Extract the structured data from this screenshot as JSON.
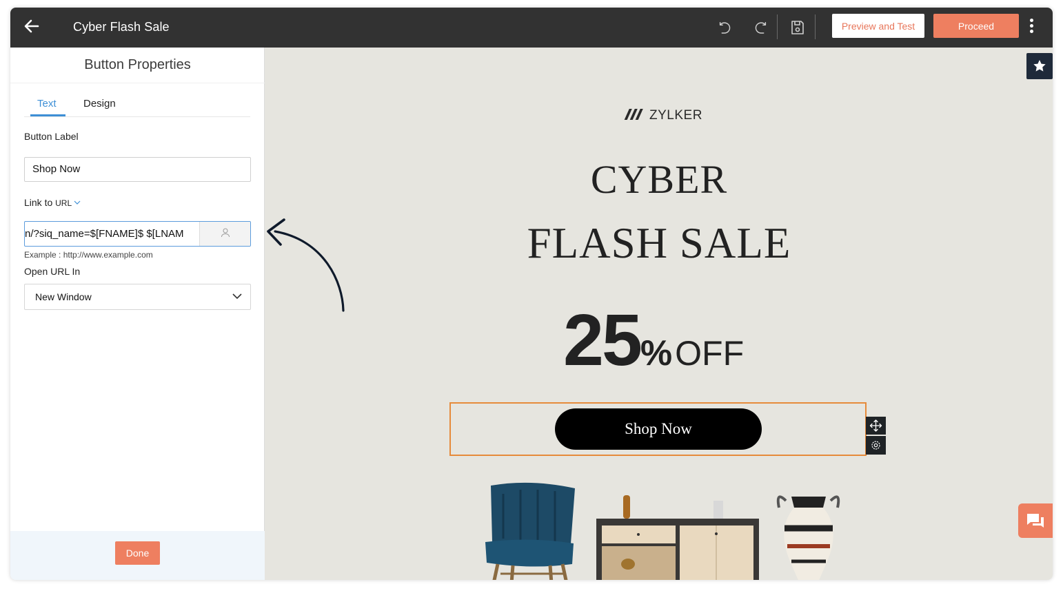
{
  "header": {
    "title": "Cyber Flash Sale",
    "preview_label": "Preview and Test",
    "proceed_label": "Proceed"
  },
  "panel": {
    "title": "Button Properties",
    "tabs": [
      {
        "label": "Text",
        "active": true
      },
      {
        "label": "Design",
        "active": false
      }
    ],
    "button_label_heading": "Button Label",
    "button_label_value": "Shop Now",
    "link_heading": "Link to",
    "link_type": "URL",
    "url_value": "n/?siq_name=$[FNAME]$ $[LNAM",
    "url_hint": "Example : http://www.example.com",
    "open_in_heading": "Open URL In",
    "open_in_value": "New Window",
    "done_label": "Done"
  },
  "email": {
    "brand": "ZYLKER",
    "headline_1": "CYBER",
    "headline_2": "FLASH SALE",
    "discount_number": "25",
    "discount_percent": "%",
    "discount_off": "OFF",
    "cta_label": "Shop Now"
  },
  "colors": {
    "accent": "#ee7f60",
    "topbar": "#323232",
    "tab_active": "#3d8fd6",
    "canvas": "#e6e5df",
    "selection": "#e68a3a"
  },
  "icons": [
    "back-arrow-icon",
    "undo-icon",
    "redo-icon",
    "save-icon",
    "more-vertical-icon",
    "star-icon",
    "user-icon",
    "chevron-down-icon",
    "move-icon",
    "gear-icon",
    "chat-icon"
  ]
}
